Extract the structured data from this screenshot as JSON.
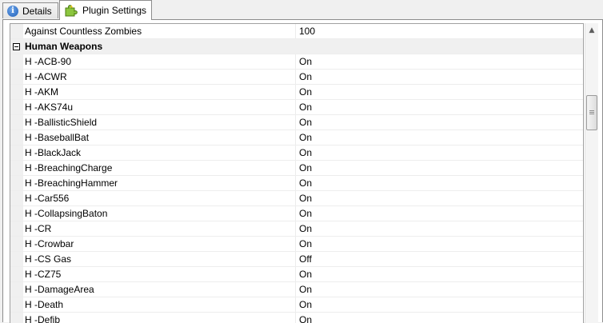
{
  "tabs": {
    "details_label": "Details",
    "plugin_label": "Plugin Settings"
  },
  "first_row": {
    "name": "Against Countless Zombies",
    "value": "100"
  },
  "category": {
    "name": "Human Weapons",
    "collapse_symbol": "−"
  },
  "rows": [
    {
      "name": "H -ACB-90",
      "value": "On"
    },
    {
      "name": "H -ACWR",
      "value": "On"
    },
    {
      "name": "H -AKM",
      "value": "On"
    },
    {
      "name": "H -AKS74u",
      "value": "On"
    },
    {
      "name": "H -BallisticShield",
      "value": "On"
    },
    {
      "name": "H -BaseballBat",
      "value": "On"
    },
    {
      "name": "H -BlackJack",
      "value": "On"
    },
    {
      "name": "H -BreachingCharge",
      "value": "On"
    },
    {
      "name": "H -BreachingHammer",
      "value": "On"
    },
    {
      "name": "H -Car556",
      "value": "On"
    },
    {
      "name": "H -CollapsingBaton",
      "value": "On"
    },
    {
      "name": "H -CR",
      "value": "On"
    },
    {
      "name": "H -Crowbar",
      "value": "On"
    },
    {
      "name": "H -CS Gas",
      "value": "Off"
    },
    {
      "name": "H -CZ75",
      "value": "On"
    },
    {
      "name": "H -DamageArea",
      "value": "On"
    },
    {
      "name": "H -Death",
      "value": "On"
    },
    {
      "name": "H -Defib",
      "value": "On"
    }
  ],
  "scrollbar": {
    "up_arrow": "▲"
  },
  "icons": {
    "details": "info-icon",
    "plugin": "puzzle-icon"
  },
  "colors": {
    "accent": "#1f5fb8",
    "category_bg": "#f0f0f0",
    "gridline": "#ededed"
  }
}
